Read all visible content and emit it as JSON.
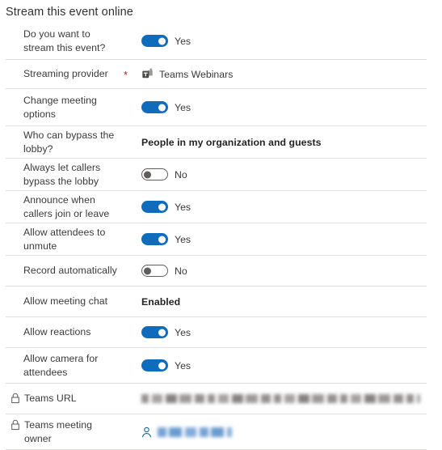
{
  "section": {
    "title": "Stream this event online"
  },
  "rows": [
    {
      "label": "Do you want to stream this event?",
      "type": "toggle",
      "state": "Yes",
      "on": true,
      "required": false,
      "locked": false,
      "height": 46
    },
    {
      "label": "Streaming provider",
      "type": "provider",
      "value": "Teams Webinars",
      "icon": "teams-icon",
      "required": true,
      "locked": false,
      "height": 36
    },
    {
      "label": "Change meeting options",
      "type": "toggle",
      "state": "Yes",
      "on": true,
      "required": false,
      "locked": false,
      "height": 46
    },
    {
      "label": "Who can bypass the lobby?",
      "type": "text",
      "value": "People in my organization and guests",
      "required": false,
      "locked": false,
      "height": 40
    },
    {
      "label": "Always let callers bypass the lobby",
      "type": "toggle",
      "state": "No",
      "on": false,
      "required": false,
      "locked": false,
      "height": 40
    },
    {
      "label": "Announce when callers join or leave",
      "type": "toggle",
      "state": "Yes",
      "on": true,
      "required": false,
      "locked": false,
      "height": 40
    },
    {
      "label": "Allow attendees to unmute",
      "type": "toggle",
      "state": "Yes",
      "on": true,
      "required": false,
      "locked": false,
      "height": 40
    },
    {
      "label": "Record automatically",
      "type": "toggle",
      "state": "No",
      "on": false,
      "required": false,
      "locked": false,
      "height": 38
    },
    {
      "label": "Allow meeting chat",
      "type": "text",
      "value": "Enabled",
      "required": false,
      "locked": false,
      "height": 38
    },
    {
      "label": "Allow reactions",
      "type": "toggle",
      "state": "Yes",
      "on": true,
      "required": false,
      "locked": false,
      "height": 38
    },
    {
      "label": "Allow camera for attendees",
      "type": "toggle",
      "state": "Yes",
      "on": true,
      "required": false,
      "locked": false,
      "height": 44
    },
    {
      "label": "Teams URL",
      "type": "redacted-url",
      "value": "",
      "required": false,
      "locked": true,
      "height": 38
    },
    {
      "label": "Teams meeting owner",
      "type": "redacted-owner",
      "value": "",
      "icon": "person-icon",
      "required": false,
      "locked": true,
      "height": 44
    }
  ],
  "colors": {
    "toggle_on": "#0f6cbd",
    "toggle_off_border": "#605e5c",
    "required_asterisk": "#a4262c",
    "divider": "#e1dfdd",
    "label_text": "#3b3a39",
    "value_text": "#242424",
    "link_blue": "#0f6cbd"
  },
  "required_marker": "*"
}
